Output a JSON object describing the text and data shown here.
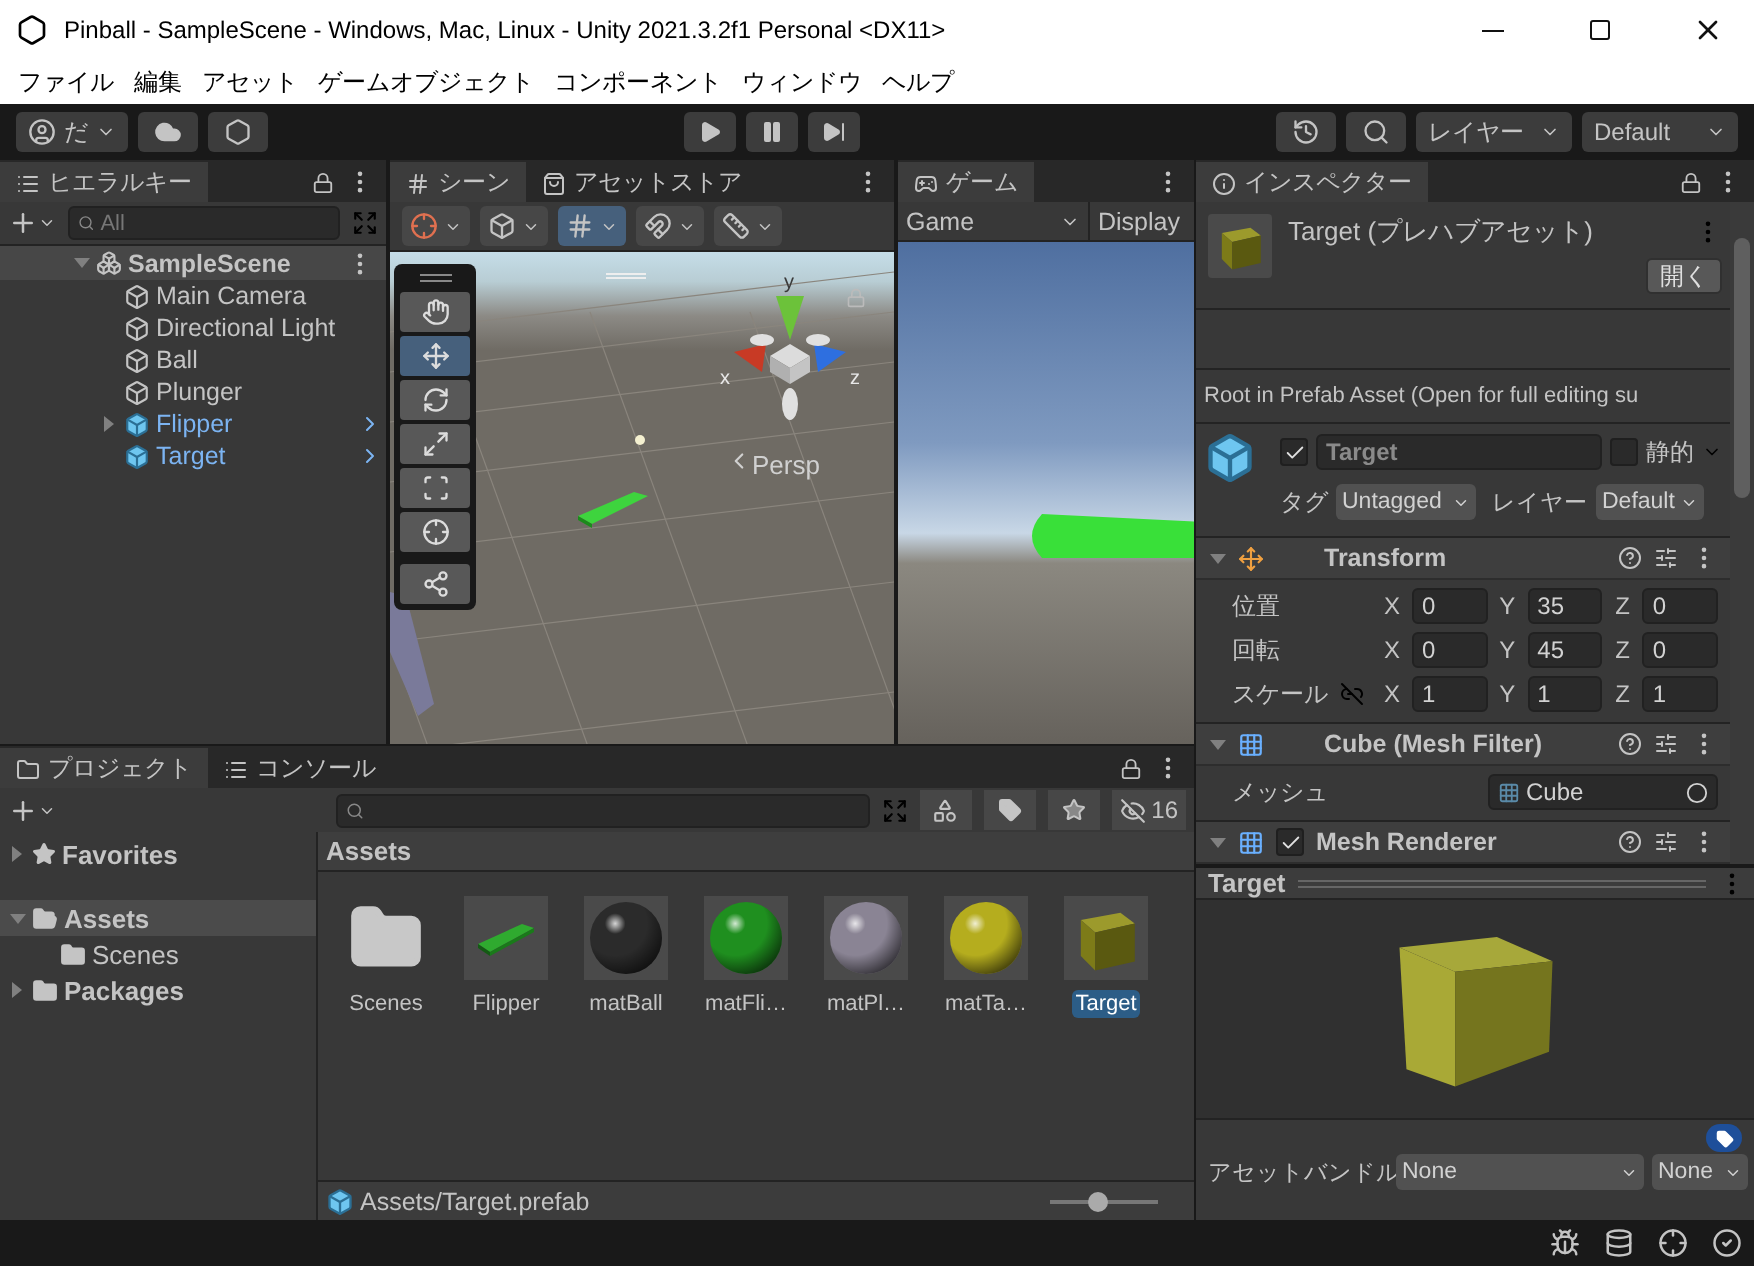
{
  "window": {
    "title": "Pinball - SampleScene - Windows, Mac, Linux - Unity 2021.3.2f1 Personal <DX11>"
  },
  "menu": [
    "ファイル",
    "編集",
    "アセット",
    "ゲームオブジェクト",
    "コンポーネント",
    "ウィンドウ",
    "ヘルプ"
  ],
  "toolbar": {
    "account": "だ",
    "layers": "レイヤー",
    "layout": "Default"
  },
  "hierarchy": {
    "tab": "ヒエラルキー",
    "search_placeholder": "All",
    "scene": "SampleScene",
    "scene_expanded": true,
    "items": [
      {
        "name": "Main Camera",
        "kind": "object",
        "has_children": false
      },
      {
        "name": "Directional Light",
        "kind": "object",
        "has_children": false
      },
      {
        "name": "Ball",
        "kind": "object",
        "has_children": false
      },
      {
        "name": "Plunger",
        "kind": "object",
        "has_children": false
      },
      {
        "name": "Flipper",
        "kind": "prefab",
        "has_children": true
      },
      {
        "name": "Target",
        "kind": "prefab",
        "has_children": false
      }
    ]
  },
  "scene_view": {
    "tabs": [
      {
        "label": "シーン",
        "kind": "scene",
        "selected": true
      },
      {
        "label": "アセットストア",
        "kind": "store",
        "selected": false
      }
    ],
    "tools": [
      {
        "kind": "hand",
        "selected": false
      },
      {
        "kind": "move",
        "selected": true
      },
      {
        "kind": "rotate",
        "selected": false
      },
      {
        "kind": "scale",
        "selected": false
      },
      {
        "kind": "rect",
        "selected": false
      },
      {
        "kind": "transform",
        "selected": false
      },
      {
        "kind": "custom",
        "selected": false
      }
    ],
    "axes": [
      "y",
      "x",
      "z"
    ],
    "camera": "Persp"
  },
  "game_view": {
    "tab": "ゲーム",
    "display_mode": "Game",
    "display": "Display"
  },
  "inspector": {
    "tab": "インスペクター",
    "title": "Target (プレハブアセット)",
    "open_button": "開く",
    "note": "Root in Prefab Asset (Open for full editing su",
    "object": {
      "active": true,
      "name": "Target",
      "static_label": "静的",
      "static": false,
      "tag_label": "タグ",
      "tag": "Untagged",
      "layer_label": "レイヤー",
      "layer": "Default"
    },
    "transform": {
      "title": "Transform",
      "expanded": true,
      "rows": [
        {
          "label": "位置",
          "kind": "plain",
          "fields": [
            {
              "axis": "X",
              "value": "0"
            },
            {
              "axis": "Y",
              "value": "35"
            },
            {
              "axis": "Z",
              "value": "0"
            }
          ]
        },
        {
          "label": "回転",
          "kind": "plain",
          "fields": [
            {
              "axis": "X",
              "value": "0"
            },
            {
              "axis": "Y",
              "value": "45"
            },
            {
              "axis": "Z",
              "value": "0"
            }
          ]
        },
        {
          "label": "スケール",
          "kind": "linkable",
          "fields": [
            {
              "axis": "X",
              "value": "1"
            },
            {
              "axis": "Y",
              "value": "1"
            },
            {
              "axis": "Z",
              "value": "1"
            }
          ]
        }
      ]
    },
    "mesh_filter": {
      "title": "Cube (Mesh Filter)",
      "expanded": true,
      "label": "メッシュ",
      "value": "Cube"
    },
    "mesh_renderer": {
      "title": "Mesh Renderer",
      "expanded": true,
      "enabled": true
    },
    "preview": {
      "title": "Target"
    },
    "asset_bundle": {
      "label": "アセットバンドル",
      "name": "None",
      "variant": "None"
    }
  },
  "project": {
    "tabs": [
      {
        "label": "プロジェクト",
        "kind": "project",
        "selected": true
      },
      {
        "label": "コンソール",
        "kind": "console",
        "selected": false
      }
    ],
    "tree": [
      {
        "name": "Favorites",
        "kind": "favorites",
        "expanded": false,
        "selected": false
      },
      {
        "name": "Assets",
        "kind": "folder",
        "expanded": true,
        "selected": true,
        "children": [
          {
            "name": "Scenes",
            "kind": "folder",
            "expanded": false,
            "selected": false
          }
        ]
      },
      {
        "name": "Packages",
        "kind": "folder",
        "expanded": false,
        "selected": false
      }
    ],
    "hidden_count": "16",
    "breadcrumb": "Assets",
    "assets": [
      {
        "name": "Scenes",
        "kind": "folder",
        "selected": false
      },
      {
        "name": "Flipper",
        "kind": "model",
        "selected": false
      },
      {
        "name": "matBall",
        "kind": "material",
        "color": "#2b2b2b",
        "selected": false
      },
      {
        "name": "matFli…",
        "kind": "material",
        "color": "#1f8f1f",
        "selected": false
      },
      {
        "name": "matPl…",
        "kind": "material",
        "color": "#8a8494",
        "selected": false
      },
      {
        "name": "matTa…",
        "kind": "material",
        "color": "#b5ad1e",
        "selected": false
      },
      {
        "name": "Target",
        "kind": "prefab",
        "selected": true
      }
    ],
    "path": "Assets/Target.prefab",
    "zoom": {
      "level": 0.45
    }
  }
}
